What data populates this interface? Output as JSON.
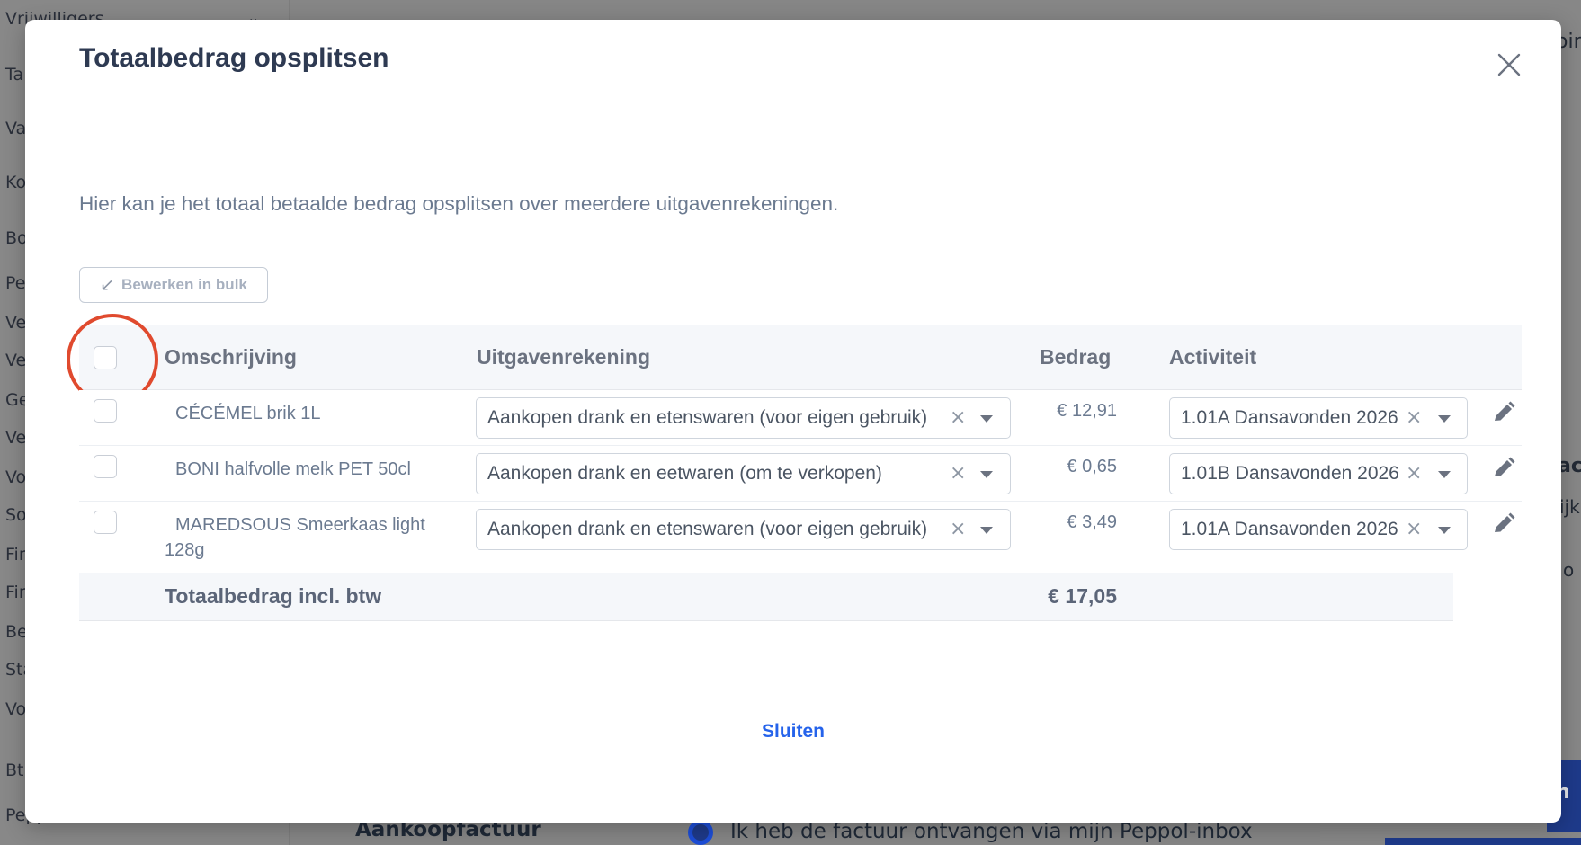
{
  "background": {
    "sidebar_items": [
      "Vrijwilligers",
      "Ta",
      "Va",
      "Ko",
      "Bo",
      "Pe",
      "Ve",
      "Ve",
      "Ge",
      "Ve",
      "Vo",
      "So",
      "Fin",
      "Fin",
      "Be",
      "Sta",
      "Vo",
      "Bt",
      "Peppol-inbox"
    ],
    "right_panel_fragments": [
      "oin",
      "ac",
      "ijk",
      "o",
      "n"
    ],
    "footer_title": "Aankoopfactuur",
    "radio_label": "Ik heb de factuur ontvangen via mijn Peppol-inbox",
    "colors": {
      "overlay": "#8a8a8a",
      "accent": "#1e3a8a"
    }
  },
  "modal": {
    "title": "Totaalbedrag opsplitsen",
    "close_icon": "close-icon",
    "intro": "Hier kan je het totaal betaalde bedrag opsplitsen over meerdere uitgavenrekeningen.",
    "bulk_button": {
      "icon": "↙",
      "label": "Bewerken in bulk"
    },
    "table": {
      "headers": {
        "description": "Omschrijving",
        "account": "Uitgavenrekening",
        "amount": "Bedrag",
        "activity": "Activiteit"
      },
      "rows": [
        {
          "description": "CÉCÉMEL brik 1L",
          "account": "Aankopen drank en etenswaren (voor eigen gebruik)",
          "amount": "€ 12,91",
          "activity": "1.01A Dansavonden 2026"
        },
        {
          "description": "BONI halfvolle melk PET 50cl",
          "account": "Aankopen drank en eetwaren (om te verkopen)",
          "amount": "€ 0,65",
          "activity": "1.01B Dansavonden 2026"
        },
        {
          "description": "MAREDSOUS Smeerkaas light 128g",
          "account": "Aankopen drank en etenswaren (voor eigen gebruik)",
          "amount": "€ 3,49",
          "activity": "1.01A Dansavonden 2026"
        }
      ],
      "total_label": "Totaalbedrag incl. btw",
      "total_amount": "€ 17,05",
      "clear_glyph": "×"
    },
    "close_link": "Sluiten",
    "colors": {
      "link": "#2563eb",
      "highlight": "#e04a2e",
      "title": "#2e3a52"
    }
  }
}
